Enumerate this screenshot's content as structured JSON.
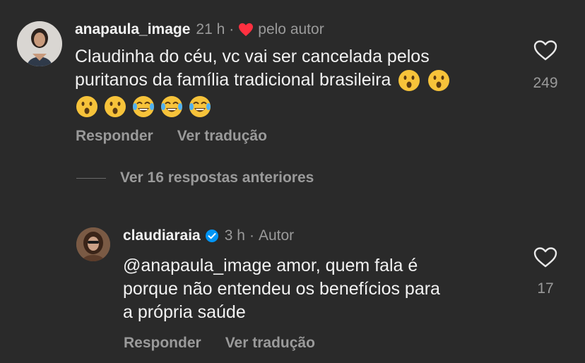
{
  "comment": {
    "username": "anapaula_image",
    "time": "21 h",
    "separator": "·",
    "liked_by_author": "pelo autor",
    "text_line1": "Claudinha do céu, vc vai ser cancelada pelos",
    "text_line2": "puritanos da família tradicional brasileira",
    "emojis_line2": [
      "astonished-face-emoji",
      "astonished-face-emoji"
    ],
    "emojis_line3": [
      "astonished-face-emoji",
      "astonished-face-emoji",
      "joy-face-emoji",
      "joy-face-emoji",
      "joy-face-emoji"
    ],
    "like_count": "249",
    "reply_label": "Responder",
    "translate_label": "Ver tradução"
  },
  "view_replies": {
    "label": "Ver 16 respostas anteriores"
  },
  "reply": {
    "username": "claudiaraia",
    "verified": true,
    "time": "3 h",
    "separator": "·",
    "author_label": "Autor",
    "text_line1": "@anapaula_image amor, quem fala é",
    "text_line2": "porque não entendeu os benefícios para",
    "text_line3": "a própria saúde",
    "like_count": "17",
    "reply_label": "Responder",
    "translate_label": "Ver tradução"
  },
  "colors": {
    "background": "#2a2a2a",
    "text": "#f2f2f2",
    "secondary": "#9a9a9a",
    "heart_red": "#ff3040",
    "verified_blue": "#0095f6"
  }
}
